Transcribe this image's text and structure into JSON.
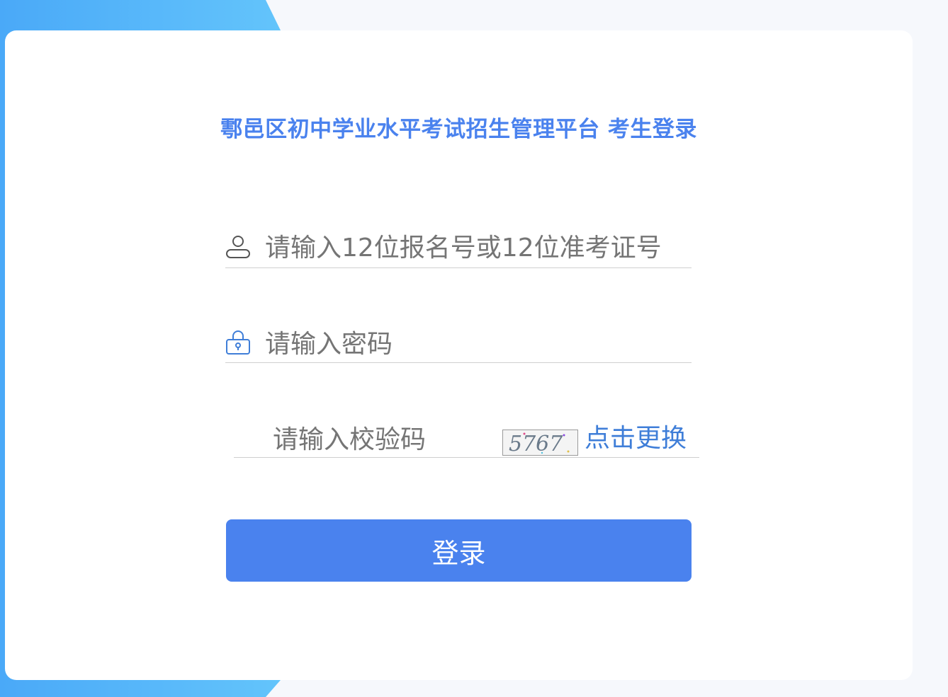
{
  "title": "鄠邑区初中学业水平考试招生管理平台 考生登录",
  "username": {
    "placeholder": "请输入12位报名号或12位准考证号",
    "icon": "user-icon"
  },
  "password": {
    "placeholder": "请输入密码",
    "icon": "lock-icon"
  },
  "captcha": {
    "placeholder": "请输入校验码",
    "image_text": "5767",
    "refresh_label": "点击更换"
  },
  "login_button": {
    "label": "登录"
  },
  "colors": {
    "accent": "#4a82ee",
    "link": "#3f7ed8",
    "background": "#f6f8fc"
  }
}
